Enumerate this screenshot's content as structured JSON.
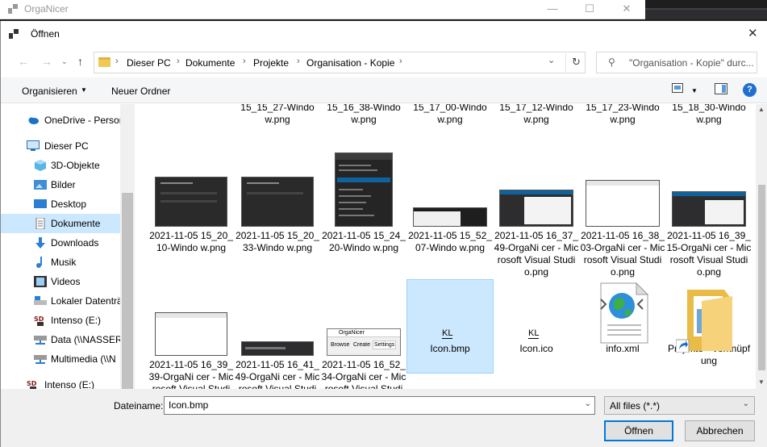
{
  "bg_window": {
    "title": "OrgaNicer",
    "minimize": "—",
    "maximize": "☐",
    "close": "✕"
  },
  "dialog": {
    "title": "Öffnen",
    "close": "✕"
  },
  "address": {
    "back": "←",
    "forward": "→",
    "up": "↑",
    "crumbs": [
      "Dieser PC",
      "Dokumente",
      "Projekte",
      "Organisation - Kopie"
    ],
    "refresh": "↻",
    "search_placeholder": "\"Organisation - Kopie\" durc...",
    "search_icon": "search-icon"
  },
  "toolbar": {
    "organize": "Organisieren",
    "new_folder": "Neuer Ordner",
    "help": "?"
  },
  "nav": {
    "items": [
      {
        "label": "OneDrive - Persor",
        "icon": "cloud-icon"
      },
      {
        "label": "Dieser PC",
        "icon": "computer-icon"
      },
      {
        "label": "3D-Objekte",
        "icon": "cube-icon"
      },
      {
        "label": "Bilder",
        "icon": "pictures-icon"
      },
      {
        "label": "Desktop",
        "icon": "desktop-icon"
      },
      {
        "label": "Dokumente",
        "icon": "document-icon"
      },
      {
        "label": "Downloads",
        "icon": "download-icon"
      },
      {
        "label": "Musik",
        "icon": "music-icon"
      },
      {
        "label": "Videos",
        "icon": "video-icon"
      },
      {
        "label": "Lokaler Datenträ",
        "icon": "drive-icon"
      },
      {
        "label": "Intenso (E:)",
        "icon": "sd-card-icon"
      },
      {
        "label": "Data (\\\\NASSER)",
        "icon": "network-drive-icon"
      },
      {
        "label": "Multimedia (\\\\N",
        "icon": "network-drive-icon"
      },
      {
        "label": "Intenso (E:)",
        "icon": "sd-card-icon"
      }
    ]
  },
  "files": {
    "row0": [
      "15_15_27-Windo w.png",
      "15_16_38-Windo w.png",
      "15_17_00-Windo w.png",
      "15_17_12-Windo w.png",
      "15_17_23-Windo w.png",
      "15_18_30-Windo w.png"
    ],
    "row1": [
      "2021-11-05 15_20_10-Windo w.png",
      "2021-11-05 15_20_33-Windo w.png",
      "2021-11-05 15_24_20-Windo w.png",
      "2021-11-05 15_52_07-Windo w.png",
      "2021-11-05 16_37_49-OrgaNi cer - Microsoft Visual Studio.png",
      "2021-11-05 16_38_03-OrgaNi cer - Microsoft Visual Studio.png",
      "2021-11-05 16_39_15-OrgaNi cer - Microsoft Visual Studio.png"
    ],
    "row2": [
      "2021-11-05 16_39_39-OrgaNi cer - Microsoft Visual Studio.png",
      "2021-11-05 16_41_49-OrgaNi cer - Microsoft Visual Studio.png",
      "2021-11-05 16_52_34-OrgaNi cer - Microsoft Visual Studio.png",
      "Icon.bmp",
      "Icon.ico",
      "info.xml",
      "Projekte - Verknüpfung"
    ],
    "kl_text": "KL",
    "thumb_tabs": [
      "Browse",
      "Create",
      "Settings"
    ],
    "thumb_title": "OrgaNicer"
  },
  "bottom": {
    "filename_label": "Dateiname:",
    "filename_value": "Icon.bmp",
    "filetype_value": "All files  (*.*)",
    "open_button": "Öffnen",
    "cancel_button": "Abbrechen"
  }
}
